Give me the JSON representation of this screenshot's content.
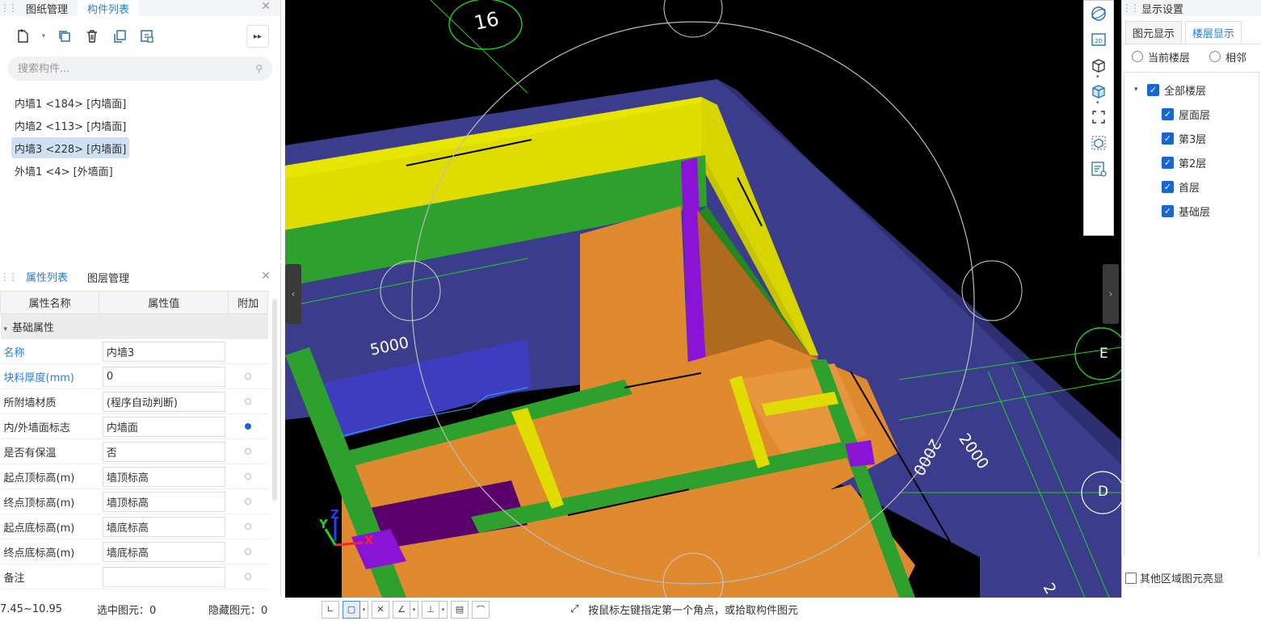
{
  "component_panel": {
    "tabs": [
      "图纸管理",
      "构件列表"
    ],
    "active_tab": 1,
    "search_placeholder": "搜索构件...",
    "components": [
      {
        "label": "内墙1 <184> [内墙面]",
        "selected": false
      },
      {
        "label": "内墙2 <113> [内墙面]",
        "selected": false
      },
      {
        "label": "内墙3 <228> [内墙面]",
        "selected": true
      },
      {
        "label": "外墙1 <4> [外墙面]",
        "selected": false
      }
    ],
    "toolbar_icons": [
      "new-icon",
      "copy-icon",
      "delete-icon",
      "duplicate-icon",
      "layer-copy-icon",
      "more-icon"
    ]
  },
  "property_panel": {
    "tabs": [
      "属性列表",
      "图层管理"
    ],
    "columns": [
      "属性名称",
      "属性值",
      "附加"
    ],
    "group": "基础属性",
    "rows": [
      {
        "name": "名称",
        "value": "内墙3",
        "blue": true,
        "dot": null
      },
      {
        "name": "块料厚度(mm)",
        "value": "0",
        "blue": true,
        "dot": false
      },
      {
        "name": "所附墙材质",
        "value": "(程序自动判断)",
        "blue": false,
        "dot": false
      },
      {
        "name": "内/外墙面标志",
        "value": "内墙面",
        "blue": false,
        "dot": true
      },
      {
        "name": "是否有保温",
        "value": "否",
        "blue": false,
        "dot": false
      },
      {
        "name": "起点顶标高(m)",
        "value": "墙顶标高",
        "blue": false,
        "dot": false
      },
      {
        "name": "终点顶标高(m)",
        "value": "墙顶标高",
        "blue": false,
        "dot": false
      },
      {
        "name": "起点底标高(m)",
        "value": "墙底标高",
        "blue": false,
        "dot": false
      },
      {
        "name": "终点底标高(m)",
        "value": "墙底标高",
        "blue": false,
        "dot": false
      },
      {
        "name": "备注",
        "value": "",
        "blue": false,
        "dot": false
      }
    ]
  },
  "viewport": {
    "labels": {
      "axis_16": "16",
      "dim_5000": "5000",
      "dim_2000_a": "2000",
      "dim_2000_b": "2000",
      "axis_E": "E",
      "axis_D": "D",
      "dim_partial": "2"
    },
    "gizmo": {
      "x": "X",
      "y": "Y",
      "z": "Z"
    }
  },
  "view_tools": [
    "orbit-icon",
    "2d-icon",
    "3d-box-icon",
    "solid-box-icon",
    "fullscreen-icon",
    "section-box-icon",
    "display-list-icon"
  ],
  "display_settings": {
    "title": "显示设置",
    "tabs": [
      "图元显示",
      "楼层显示"
    ],
    "active_tab": 1,
    "radio_options": [
      "当前楼层",
      "相邻"
    ],
    "floors_root": "全部楼层",
    "floors": [
      "屋面层",
      "第3层",
      "第2层",
      "首层",
      "基础层"
    ],
    "bottom_option": "其他区域图元亮显"
  },
  "statusbar": {
    "elevation": "7.45~10.95",
    "selected": "选中图元：0",
    "hidden": "隐藏图元：0",
    "hint": "按鼠标左键指定第一个角点，或拾取构件图元"
  }
}
